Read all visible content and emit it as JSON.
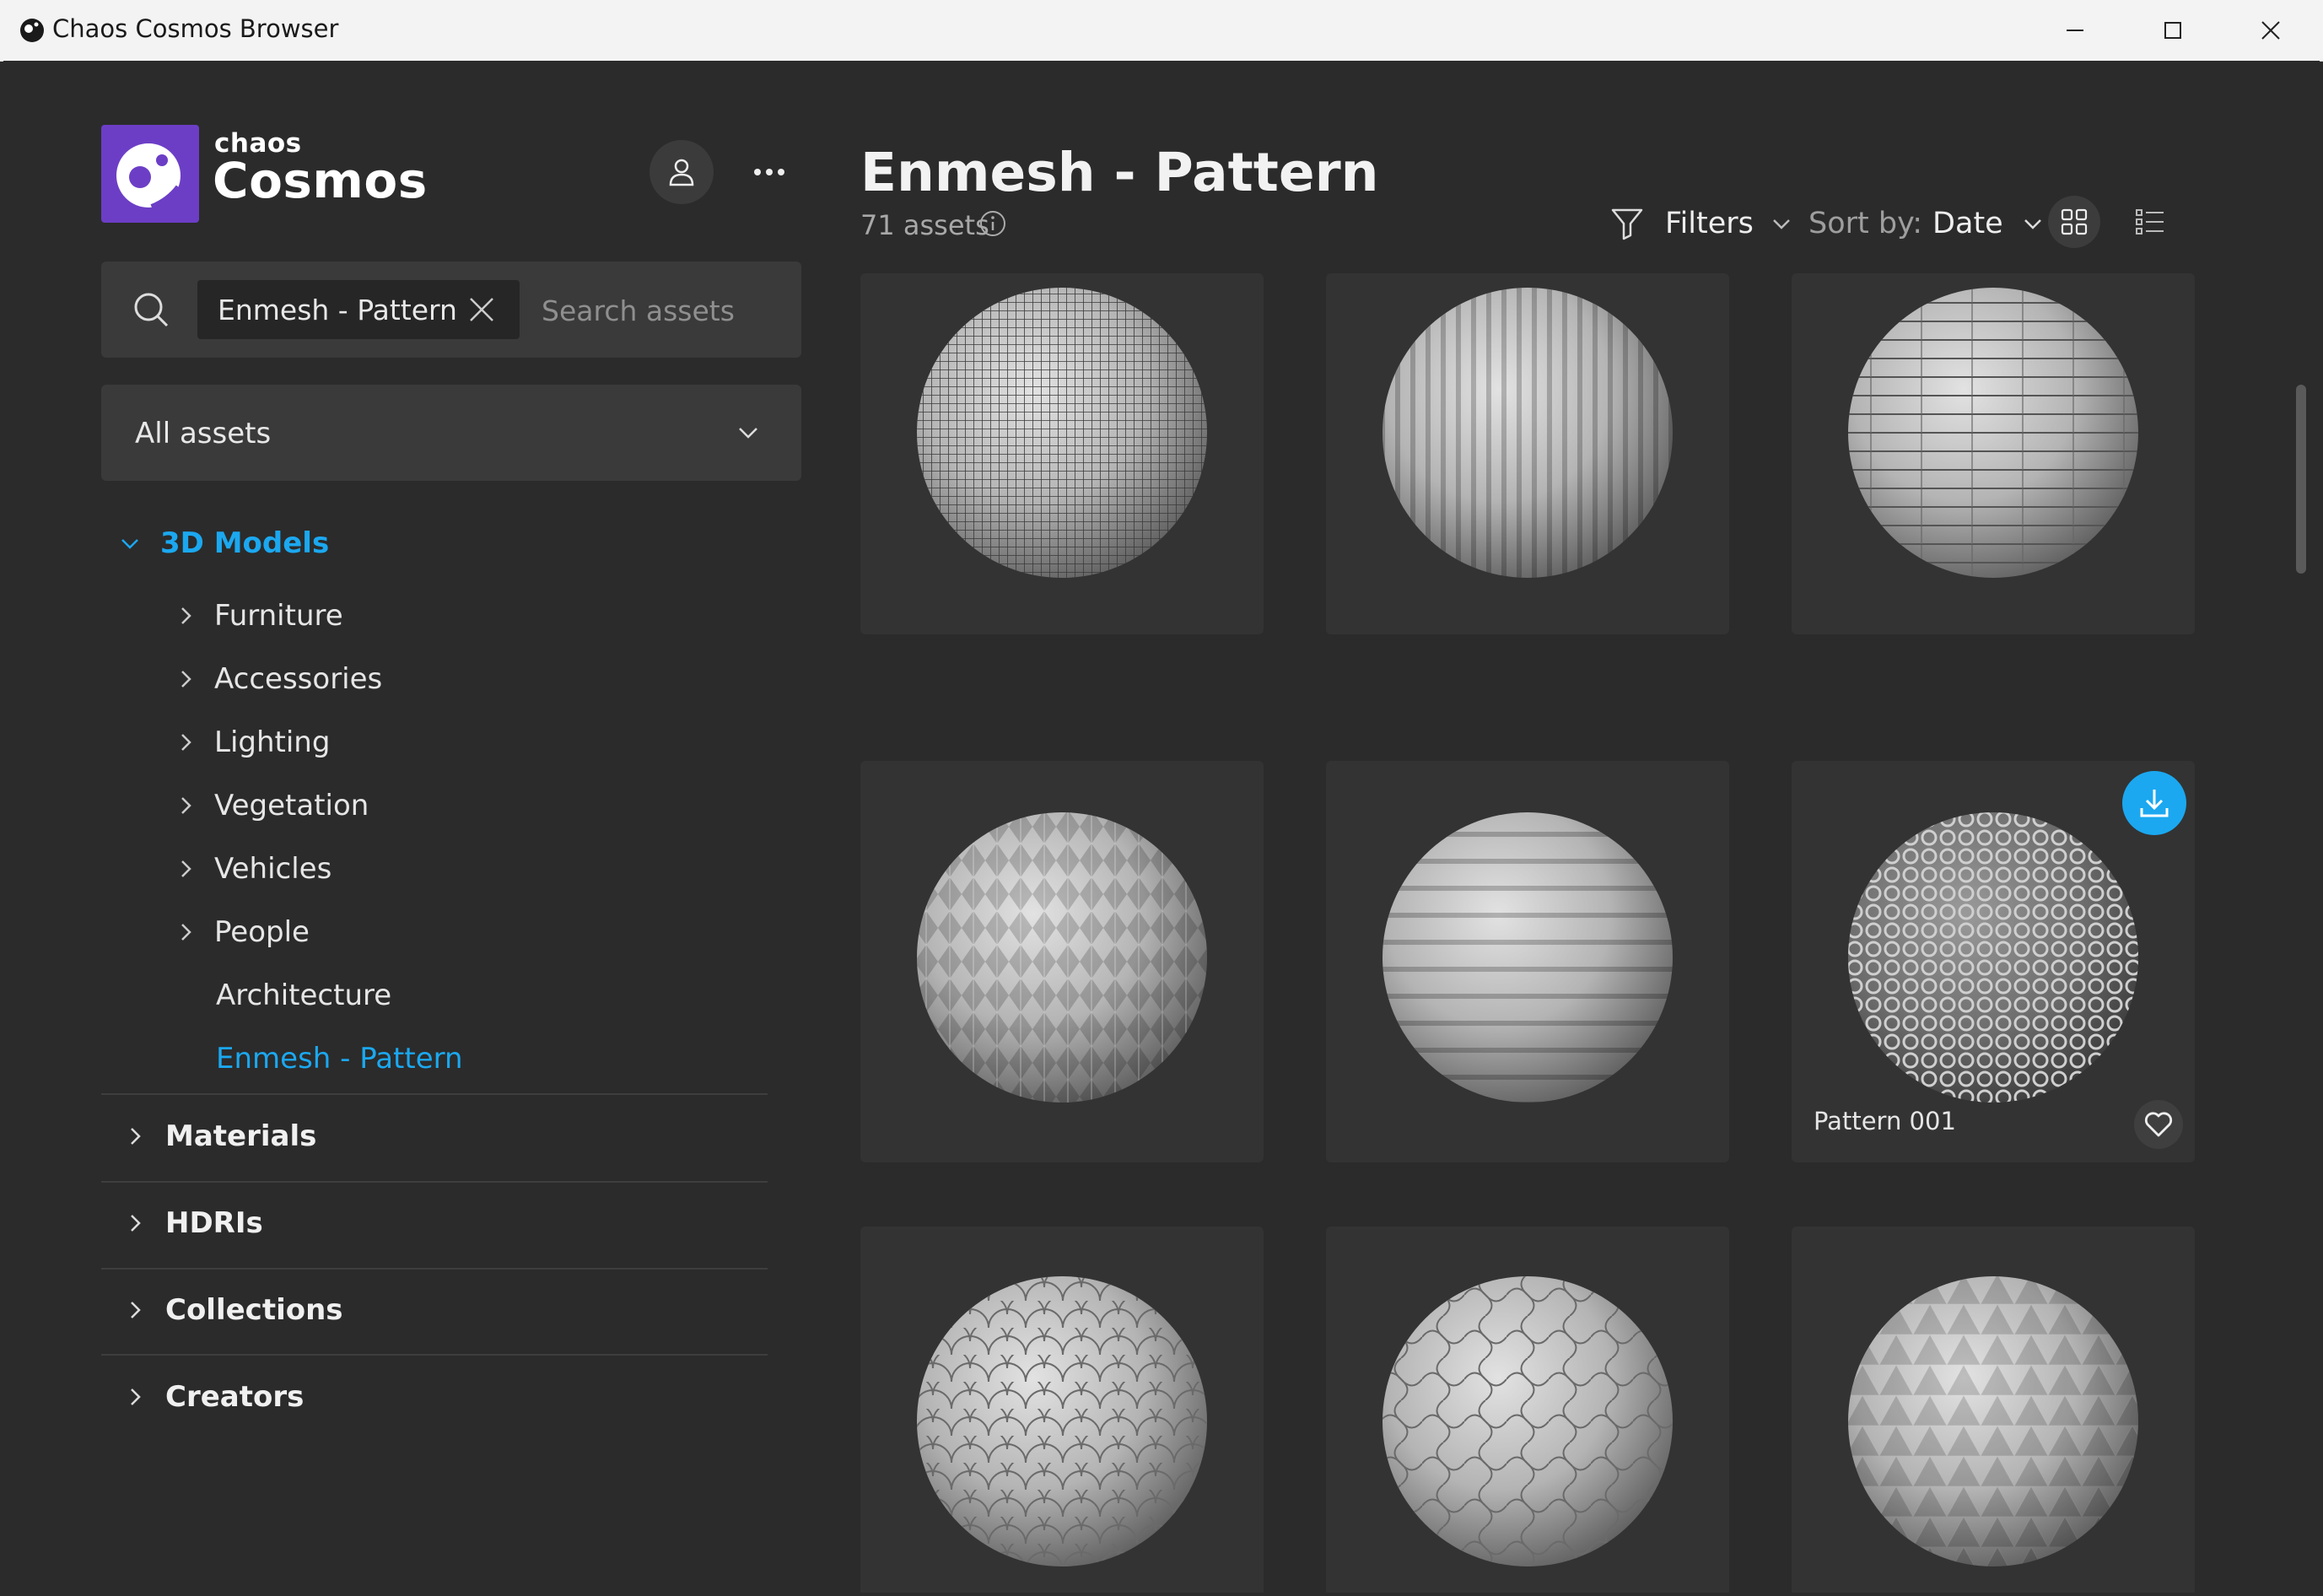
{
  "window": {
    "title": "Chaos Cosmos Browser"
  },
  "brand": {
    "small": "chaos",
    "big": "Cosmos",
    "color": "#6c3ec6"
  },
  "search": {
    "chip": "Enmesh - Pattern",
    "placeholder": "Search assets"
  },
  "asset_filter": {
    "selected": "All assets"
  },
  "sidebar": {
    "active_category": "3D Models",
    "subcategories": [
      "Furniture",
      "Accessories",
      "Lighting",
      "Vegetation",
      "Vehicles",
      "People"
    ],
    "leaf_items": [
      "Architecture",
      "Enmesh - Pattern"
    ],
    "active_leaf": "Enmesh - Pattern",
    "categories": [
      "Materials",
      "HDRIs",
      "Collections",
      "Creators"
    ]
  },
  "main": {
    "title": "Enmesh - Pattern",
    "count": "71 assets",
    "filters_label": "Filters",
    "sort_prefix": "Sort by:",
    "sort_value": "Date"
  },
  "cards": [
    {
      "pattern": "fine-grid-mesh"
    },
    {
      "pattern": "vertical-ribs"
    },
    {
      "pattern": "horizontal-shingles"
    },
    {
      "pattern": "diamond-spikes"
    },
    {
      "pattern": "horizontal-bands"
    },
    {
      "pattern": "circular-lattice",
      "name": "Pattern 001",
      "hovered": true
    },
    {
      "pattern": "fish-scales"
    },
    {
      "pattern": "interlocking-tiles"
    },
    {
      "pattern": "triangular-pyramids"
    }
  ],
  "colors": {
    "accent": "#1ba8f0",
    "background": "#2b2b2b",
    "card": "#333333"
  }
}
